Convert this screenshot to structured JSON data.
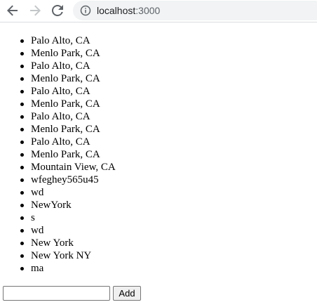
{
  "browser": {
    "url_host": "localhost",
    "url_port": ":3000",
    "icons": {
      "back": "arrow-left-icon",
      "forward": "arrow-right-icon",
      "reload": "reload-icon",
      "site_info": "info-icon"
    },
    "colors": {
      "back_icon": "#5f6368",
      "forward_icon": "#c4c7c9",
      "omnibox_bg": "#f1f3f4"
    }
  },
  "city_list": [
    "Palo Alto, CA",
    "Menlo Park, CA",
    "Palo Alto, CA",
    "Menlo Park, CA",
    "Palo Alto, CA",
    "Menlo Park, CA",
    "Palo Alto, CA",
    "Menlo Park, CA",
    "Palo Alto, CA",
    "Menlo Park, CA",
    "Mountain View, CA",
    "wfeghey565u45",
    "wd",
    "NewYork",
    "s",
    "wd",
    "New York",
    "New York NY",
    "ma"
  ],
  "form": {
    "input_value": "",
    "add_label": "Add"
  }
}
